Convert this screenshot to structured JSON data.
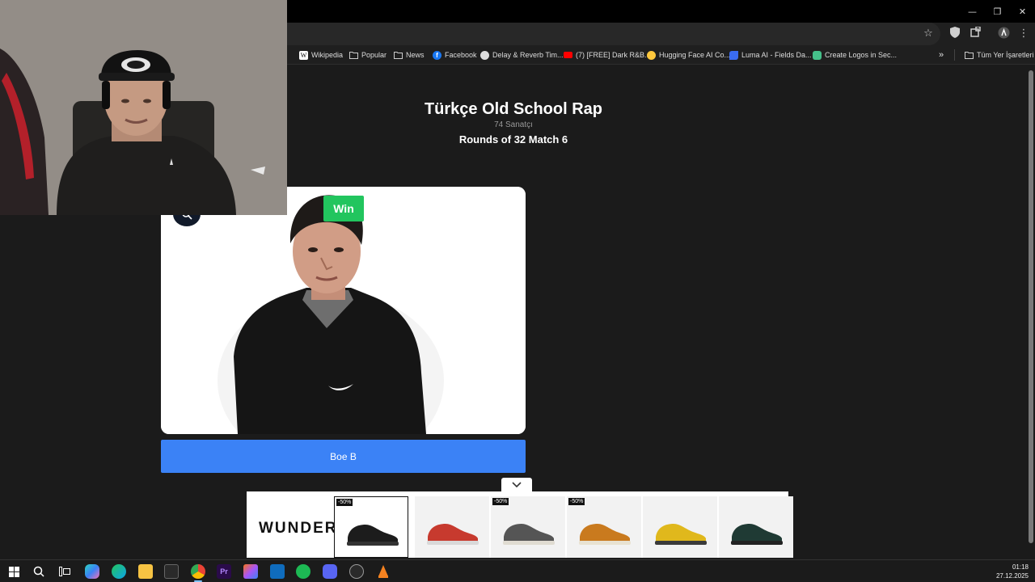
{
  "window": {
    "controls": [
      "—",
      "❐",
      "✕"
    ]
  },
  "bookmarks_bar": {
    "items": [
      {
        "label": "Wikipedia",
        "icon": "wikipedia-icon"
      },
      {
        "label": "Popular",
        "icon": "folder-icon"
      },
      {
        "label": "News",
        "icon": "folder-icon"
      },
      {
        "label": "Facebook",
        "icon": "facebook-icon"
      },
      {
        "label": "Delay & Reverb Tim...",
        "icon": "site-icon"
      },
      {
        "label": "(7) [FREE] Dark R&B...",
        "icon": "youtube-icon"
      },
      {
        "label": "Hugging Face AI Co...",
        "icon": "hugging-face-icon"
      },
      {
        "label": "Luma AI - Fields Da...",
        "icon": "luma-icon"
      },
      {
        "label": "Create Logos in Sec...",
        "icon": "site-icon"
      }
    ],
    "overflow": "»",
    "all_bookmarks": "Tüm Yer İşaretleri"
  },
  "page": {
    "title": "Türkçe Old School Rap",
    "artist_count": "74 Sanatçı",
    "round_label": "Rounds of 32 Match 6",
    "win_badge": "Win",
    "candidate_name": "Boe B",
    "zoom_icon": "search-icon"
  },
  "ad": {
    "brand": "WUNDER",
    "collapse_icon": "chevron-down-icon",
    "products": [
      {
        "discount": "-50%",
        "color": "#1c1c1c",
        "sole": "#333333",
        "selected": true
      },
      {
        "discount": "",
        "color": "#c73a2e",
        "sole": "#d9d9d9",
        "selected": false
      },
      {
        "discount": "-50%",
        "color": "#555555",
        "sole": "#e0dcd2",
        "selected": false
      },
      {
        "discount": "-50%",
        "color": "#c97a1e",
        "sole": "#e8e2d2",
        "selected": false
      },
      {
        "discount": "",
        "color": "#e0b81c",
        "sole": "#3a3a3a",
        "selected": false
      },
      {
        "discount": "",
        "color": "#1f3a34",
        "sole": "#222222",
        "selected": false
      }
    ]
  },
  "taskbar": {
    "time": "01:18",
    "date": "27.12.2025"
  },
  "colors": {
    "win": "#22c55e",
    "name_button": "#3b82f6",
    "page_bg": "#1b1b1b"
  }
}
